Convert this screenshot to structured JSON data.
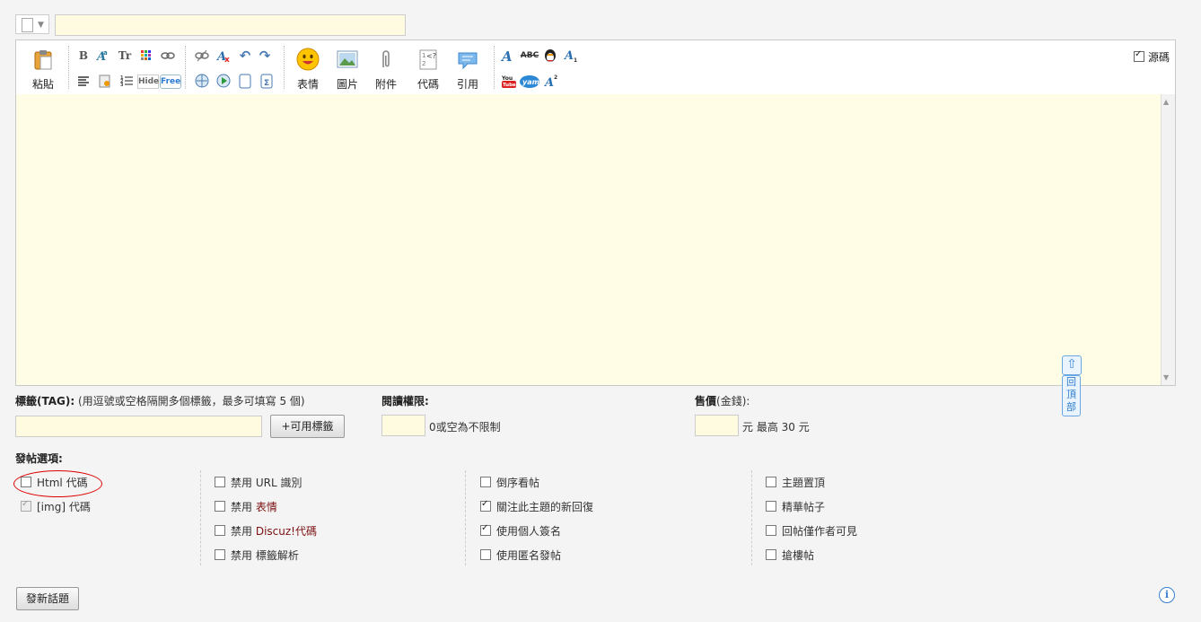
{
  "header": {
    "subject_value": ""
  },
  "toolbar": {
    "paste_label": "粘貼",
    "emoji_label": "表情",
    "image_label": "圖片",
    "attach_label": "附件",
    "code_label": "代碼",
    "quote_label": "引用",
    "source_label": "源碼",
    "small_buttons": [
      "B",
      "A",
      "Tr",
      "Hide",
      "Free",
      "ABC",
      "A"
    ]
  },
  "tags": {
    "label": "標籤(TAG):",
    "hint": " (用逗號或空格隔開多個標籤，最多可填寫 5 個)",
    "button": "+可用標籤"
  },
  "read_perm": {
    "label": "閱讀權限:",
    "suffix": "0或空為不限制"
  },
  "price": {
    "label": "售價",
    "unit_label": "(金錢):",
    "suffix": "元 最高 30 元"
  },
  "options": {
    "title": "發帖選項:",
    "col1": [
      {
        "label": "Html 代碼",
        "checked": false
      },
      {
        "label": "[img] 代碼",
        "checked": true,
        "disabled": true
      }
    ],
    "col2": [
      {
        "prefix": "禁用 ",
        "label": "URL 識別"
      },
      {
        "prefix": "禁用 ",
        "label": "表情"
      },
      {
        "prefix": "禁用 ",
        "label": "Discuz!代碼"
      },
      {
        "prefix": "禁用 ",
        "label": "標籤解析"
      }
    ],
    "col3": [
      {
        "label": "倒序看帖",
        "checked": false
      },
      {
        "label": "關注此主題的新回復",
        "checked": true
      },
      {
        "label": "使用個人簽名",
        "checked": true
      },
      {
        "label": "使用匿名發帖",
        "checked": false
      }
    ],
    "col4": [
      {
        "label": "主題置頂"
      },
      {
        "label": "精華帖子"
      },
      {
        "label": "回帖僅作者可見"
      },
      {
        "label": "搶樓帖"
      }
    ]
  },
  "submit": {
    "label": "發新話題"
  },
  "back_to_top": {
    "label": "回頂部",
    "chars": [
      "回",
      "頂",
      "部"
    ]
  },
  "info": {
    "glyph": "i"
  },
  "colors": {
    "editor_bg": "#fffde6",
    "annotation": "#dd0000",
    "link_blue": "#3a7fd0"
  }
}
